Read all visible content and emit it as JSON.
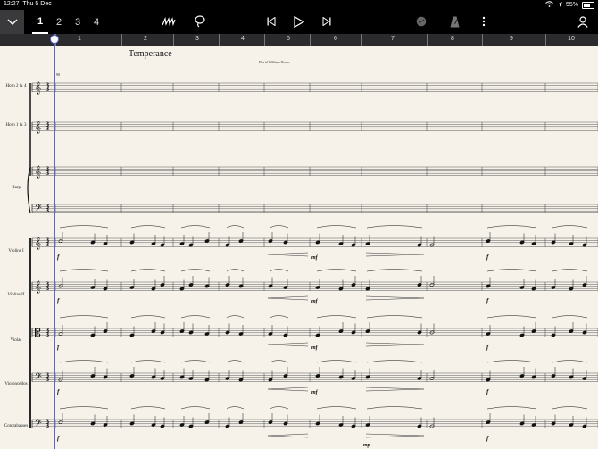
{
  "status": {
    "time": "12:27",
    "date": "Thu 5 Dec",
    "battery": "55%"
  },
  "toolbar": {
    "tabs": [
      "1",
      "2",
      "3",
      "4"
    ],
    "icons": [
      "chevron-down-icon",
      "draw-icon",
      "lasso-icon",
      "skip-back-icon",
      "play-icon",
      "skip-forward-icon",
      "mixer-icon",
      "metronome-icon",
      "more-icon",
      "profile-icon"
    ]
  },
  "ruler": {
    "bars": [
      "1",
      "2",
      "3",
      "4",
      "5",
      "6",
      "7",
      "8",
      "9",
      "10"
    ]
  },
  "score": {
    "title": "Temperance",
    "composer": "David William Hearn",
    "tempo": "90",
    "instruments": [
      "Horn 2 & 4",
      "Horn 1 & 3",
      "Harp",
      "Violins I",
      "Violins II",
      "Violas",
      "Violoncellos",
      "Contrabasses"
    ],
    "dynamics": [
      "f",
      "mf",
      "mp"
    ]
  }
}
